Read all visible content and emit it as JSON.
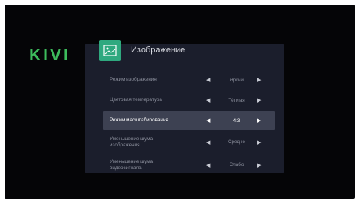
{
  "brand": {
    "logo_text": "KIVI"
  },
  "panel": {
    "icon": "picture-icon",
    "title": "Изображение"
  },
  "settings": [
    {
      "label": "Режим изображения",
      "value": "Яркий",
      "selected": false
    },
    {
      "label": "Цветовая температура",
      "value": "Тёплая",
      "selected": false
    },
    {
      "label": "Режим масштабирования",
      "value": "4:3",
      "selected": true
    },
    {
      "label": "Уменьшение шума изображения",
      "value": "Средне",
      "selected": false
    },
    {
      "label": "Уменьшение шума видеосигнала",
      "value": "Слабо",
      "selected": false
    }
  ],
  "colors": {
    "accent": "#2fa97f",
    "brand": "#3dbb5c",
    "panel": "#1b1e2c",
    "selected_row": "#3d4152"
  }
}
